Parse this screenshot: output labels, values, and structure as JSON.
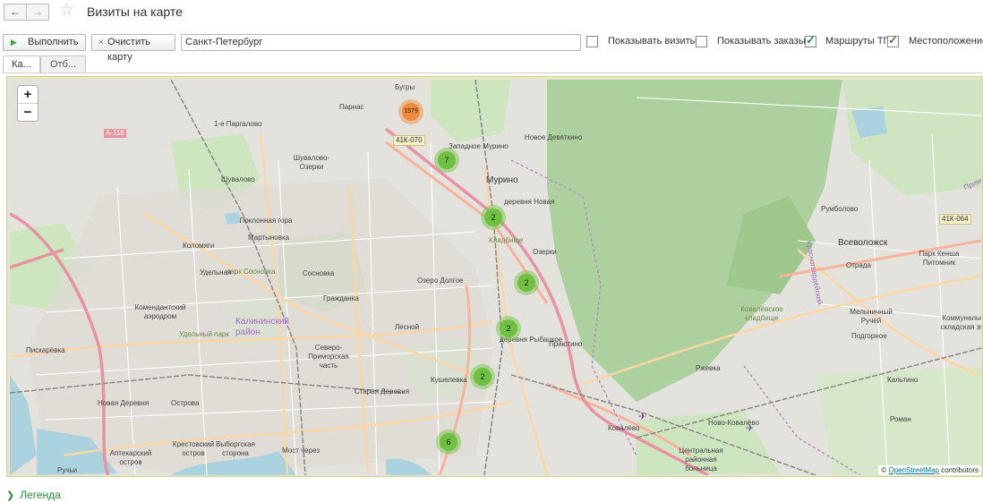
{
  "window": {
    "title": "Визиты на карте",
    "back_icon": "arrow-left-icon",
    "forward_icon": "arrow-right-icon",
    "favorite_icon": "star-icon"
  },
  "toolbar": {
    "run_label": "Выполнить",
    "clear_label": "Очистить карту",
    "city_value": "Санкт-Петербург",
    "options": [
      {
        "label": "Показывать визиты",
        "checked": false
      },
      {
        "label": "Показывать заказы",
        "checked": false
      },
      {
        "label": "Маршруты ТП",
        "checked": true
      },
      {
        "label": "Местоположение Т",
        "checked": true
      }
    ]
  },
  "tabs": [
    {
      "label": "Ка..."
    },
    {
      "label": "Отб..."
    }
  ],
  "map": {
    "zoom_in": "+",
    "zoom_out": "−",
    "attribution_prefix": "© ",
    "attribution_link": "OpenStreetMap",
    "attribution_suffix": " contributors",
    "colors": {
      "water": "#aad3df",
      "forest": "#add19e",
      "park": "#c8facc",
      "residential": "#e0dfdf",
      "motorway": "#e892a2",
      "trunk": "#f9b29c",
      "primary": "#fcd6a4",
      "cluster_green": "#6ec040",
      "cluster_orange": "#f08a3c"
    },
    "labels": [
      "Бугры",
      "Парнас",
      "1-е Паргалово",
      "Шувалово-Озерки",
      "Шувалово",
      "Западное Мурино",
      "Новое Девяткино",
      "Мурино",
      "деревня Новая",
      "Озерки",
      "Поклонная гора",
      "Мартыновка",
      "Коломяги",
      "Удельная",
      "парк Сосновка",
      "Сосновка",
      "Гражданка",
      "Озеро Долгое",
      "Комендантский аэродром",
      "Удельный парк",
      "Калининский район",
      "Лесной",
      "Северо-Приморская часть",
      "Пискарёвка",
      "Кушелевка",
      "Старая Деревня",
      "Новая Деревня",
      "Острова",
      "Крестовский остров",
      "Аптекарский остров",
      "Выборгская сторона",
      "Мост через",
      "Ручьи",
      "деревня Рыбацкое",
      "Приютино",
      "Ковалёвское кладбище",
      "Ржевка",
      "Ковалёво",
      "Ново-Ковалёво",
      "Центральная районная больница",
      "Румболово",
      "Всеволожск",
      "Отрада",
      "Парк Кенша Питомник",
      "Мельничный Ручей",
      "Коммунально-складская зона",
      "Подгорное",
      "Кальтино",
      "Роман",
      "Приморский",
      "А-118",
      "41К-070",
      "41К-064",
      "Красногвардейский",
      "Кладбище"
    ],
    "clusters": [
      {
        "count": "1579",
        "kind": "orange"
      },
      {
        "count": "7",
        "kind": "green"
      },
      {
        "count": "2",
        "kind": "green"
      },
      {
        "count": "2",
        "kind": "green"
      },
      {
        "count": "2",
        "kind": "green"
      },
      {
        "count": "2",
        "kind": "green"
      },
      {
        "count": "6",
        "kind": "green"
      }
    ]
  },
  "legend": {
    "label": "Легенда",
    "chevron_icon": "chevron-right-icon"
  }
}
